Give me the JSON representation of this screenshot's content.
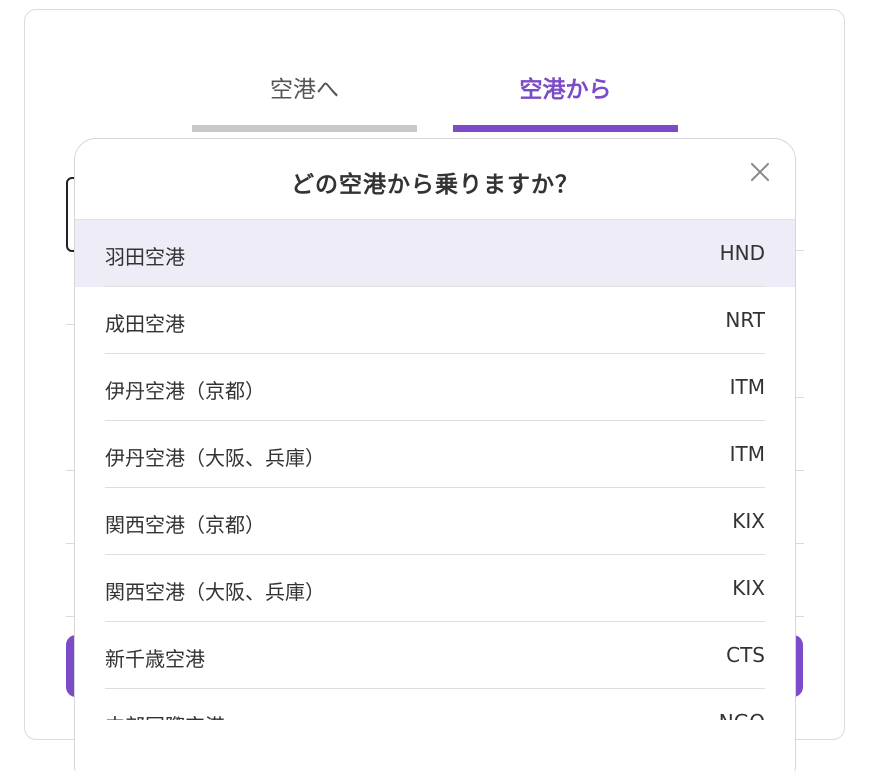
{
  "tabs": {
    "to_airport": "空港へ",
    "from_airport": "空港から"
  },
  "colors": {
    "accent": "#7b4bc8",
    "selected_row": "#eeecf7",
    "inactive_tab": "#c8c8c8"
  },
  "modal": {
    "title": "どの空港から乗りますか？",
    "close_icon": "close-icon",
    "airports": [
      {
        "name": "羽田空港",
        "code": "HND",
        "selected": true
      },
      {
        "name": "成田空港",
        "code": "NRT",
        "selected": false
      },
      {
        "name": "伊丹空港（京都）",
        "code": "ITM",
        "selected": false
      },
      {
        "name": "伊丹空港（大阪、兵庫）",
        "code": "ITM",
        "selected": false
      },
      {
        "name": "関西空港（京都）",
        "code": "KIX",
        "selected": false
      },
      {
        "name": "関西空港（大阪、兵庫）",
        "code": "KIX",
        "selected": false
      },
      {
        "name": "新千歳空港",
        "code": "CTS",
        "selected": false
      },
      {
        "name": "中部国際空港",
        "code": "NGO",
        "selected": false
      }
    ]
  }
}
